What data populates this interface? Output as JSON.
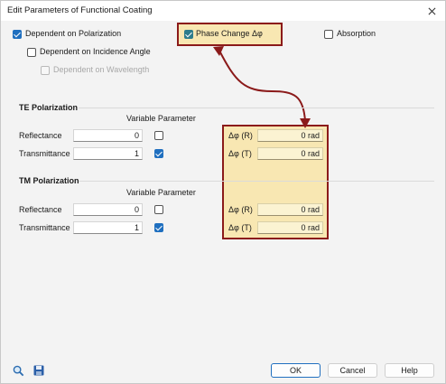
{
  "window": {
    "title": "Edit Parameters of Functional Coating"
  },
  "options": {
    "dependent_on_polarization": {
      "label": "Dependent on Polarization",
      "checked": true
    },
    "dependent_on_incidence_angle": {
      "label": "Dependent on Incidence Angle",
      "checked": false
    },
    "dependent_on_wavelength": {
      "label": "Dependent on Wavelength",
      "checked": false,
      "enabled": false
    },
    "phase_change": {
      "label": "Phase Change Δφ",
      "checked": true
    },
    "absorption": {
      "label": "Absorption",
      "checked": false
    }
  },
  "te": {
    "title": "TE Polarization",
    "variable_parameter_header": "Variable Parameter",
    "reflectance": {
      "label": "Reflectance",
      "value": "0",
      "variable": false,
      "phase_label": "Δφ (R)",
      "phase_value": "0 rad"
    },
    "transmittance": {
      "label": "Transmittance",
      "value": "1",
      "variable": true,
      "phase_label": "Δφ (T)",
      "phase_value": "0 rad"
    }
  },
  "tm": {
    "title": "TM Polarization",
    "variable_parameter_header": "Variable Parameter",
    "reflectance": {
      "label": "Reflectance",
      "value": "0",
      "variable": false,
      "phase_label": "Δφ (R)",
      "phase_value": "0 rad"
    },
    "transmittance": {
      "label": "Transmittance",
      "value": "1",
      "variable": true,
      "phase_label": "Δφ (T)",
      "phase_value": "0 rad"
    }
  },
  "footer": {
    "ok_label": "OK",
    "cancel_label": "Cancel",
    "help_label": "Help",
    "left_icons": [
      "magnifier-icon",
      "save-icon"
    ]
  },
  "colors": {
    "highlight_border": "#8b1a1a",
    "highlight_fill": "#f8e7b2",
    "checkbox_blue": "#1f6fbf"
  }
}
